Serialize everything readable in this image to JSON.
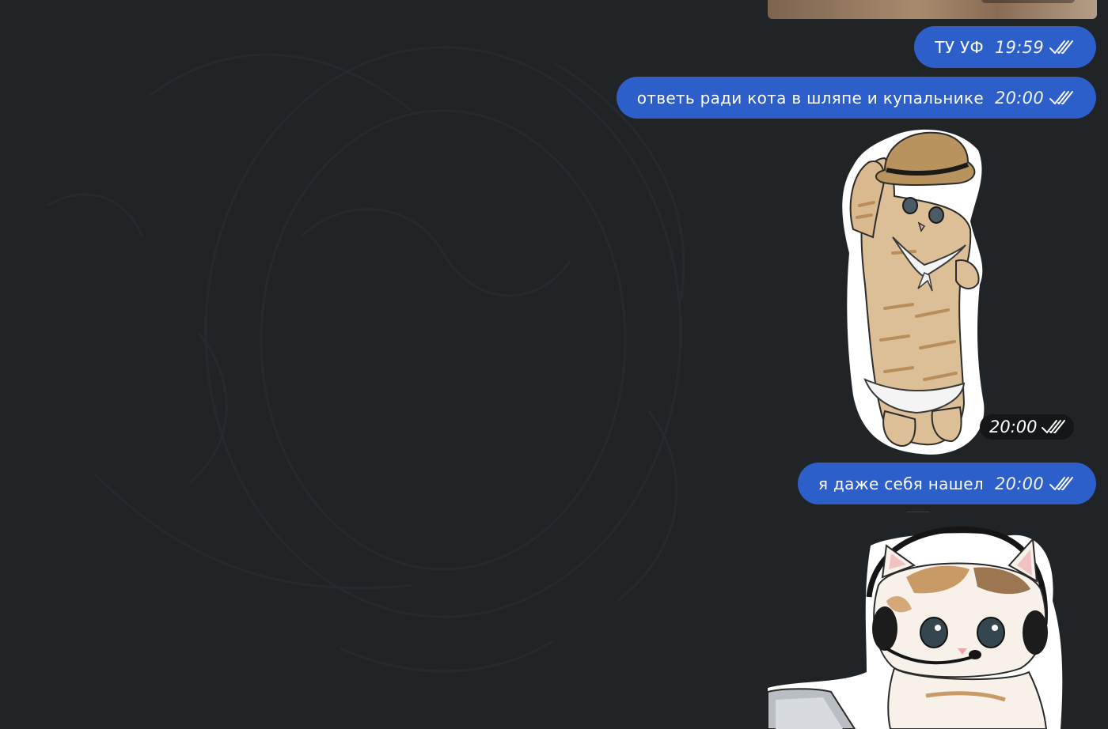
{
  "colors": {
    "background": "#212427",
    "outgoing_bubble": "#2d5fcb",
    "bubble_text": "#ffffff",
    "sticker_time_badge": "#141618"
  },
  "messages": [
    {
      "text": "ТУ УФ",
      "time": "19:59",
      "status_icon": "double-check-icon"
    },
    {
      "text": "ответь ради кота в шляпе и купальнике",
      "time": "20:00",
      "status_icon": "double-check-icon"
    },
    {
      "sticker": "cat-in-hat-and-swimsuit",
      "time": "20:00",
      "status_icon": "double-check-icon"
    },
    {
      "text": "я даже себя нашел",
      "time": "20:00",
      "status_icon": "double-check-icon"
    },
    {
      "sticker": "cat-with-headset-and-laptop"
    }
  ]
}
